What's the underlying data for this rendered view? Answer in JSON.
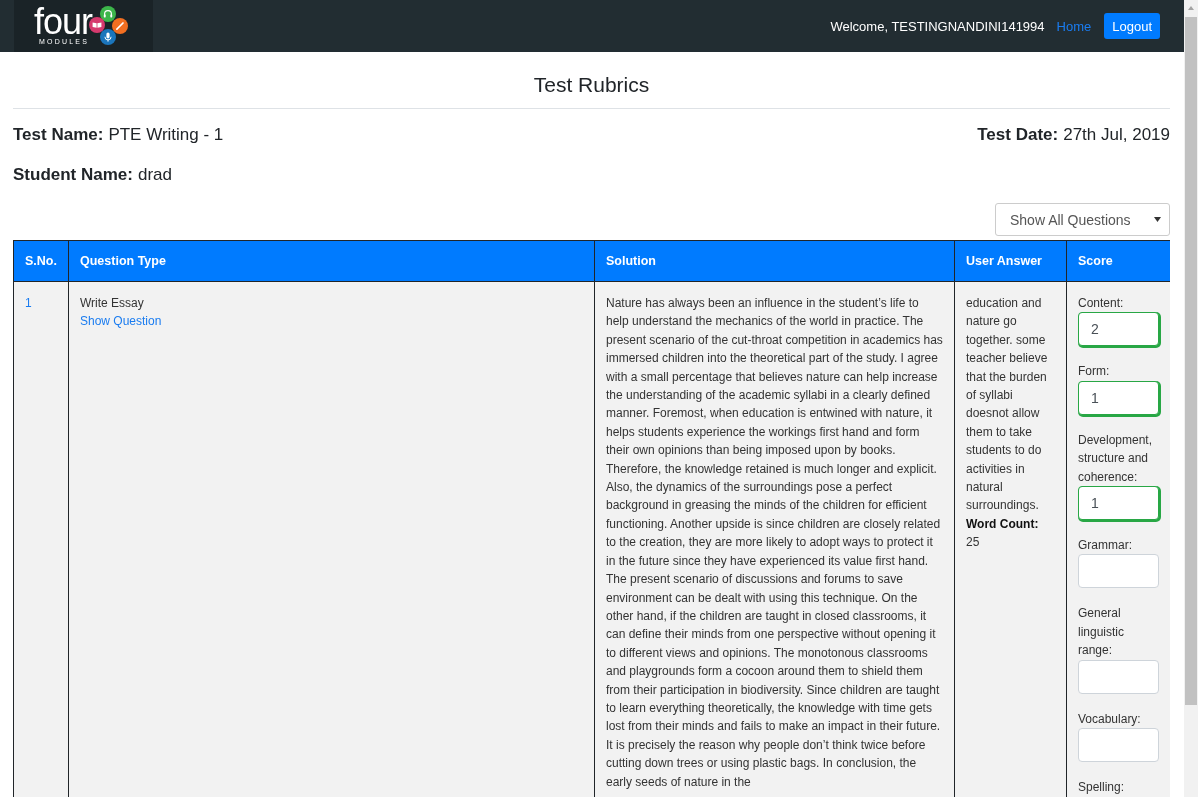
{
  "navbar": {
    "logo": {
      "word": "four",
      "tagline": "MODULES"
    },
    "welcome": "Welcome, TESTINGNANDINI141994",
    "links": [
      {
        "label": "Home",
        "kind": "link"
      },
      {
        "label": "Logout",
        "kind": "button"
      }
    ]
  },
  "page": {
    "title": "Test Rubrics",
    "test_name": {
      "label": "Test Name:",
      "value": "PTE Writing - 1"
    },
    "test_date": {
      "label": "Test Date:",
      "value": "27th Jul, 2019"
    },
    "student_name": {
      "label": "Student Name:",
      "value": "drad"
    },
    "filter": {
      "value": "Show All Questions"
    }
  },
  "table": {
    "columns": [
      "S.No.",
      "Question Type",
      "Solution",
      "User Answer",
      "Score"
    ],
    "rows": [
      {
        "number": "1",
        "question_type": "Write Essay",
        "show_question": "Show Question",
        "solution": "Nature has always been an influence in the student’s life to help understand the mechanics of the world in practice. The present scenario of the cut-throat competition in academics has immersed children into the theoretical part of the study. I agree with a small percentage that believes nature can help increase the understanding of the academic syllabi in a clearly defined manner. Foremost, when education is entwined with nature, it helps students experience the workings first hand and form their own opinions than being imposed upon by books. Therefore, the knowledge retained is much longer and explicit. Also, the dynamics of the surroundings pose a perfect background in greasing the minds of the children for efficient functioning. Another upside is since children are closely related to the creation, they are more likely to adopt ways to protect it in the future since they have experienced its value first hand. The present scenario of discussions and forums to save environment can be dealt with using this technique. On the other hand, if the children are taught in closed classrooms, it can define their minds from one perspective without opening it to different views and opinions. The monotonous classrooms and playgrounds form a cocoon around them to shield them from their participation in biodiversity. Since children are taught to learn everything theoretically, the knowledge with time gets lost from their minds and fails to make an impact in their future. It is precisely the reason why people don’t think twice before cutting down trees or using plastic bags. In conclusion, the early seeds of nature in the",
        "user_answer": "education and nature go together. some teacher believe that the burden of syllabi doesnot allow them to take students to do activities in natural surroundings.",
        "word_count_label": "Word Count:",
        "word_count": "25",
        "scores": [
          {
            "label": "Content:",
            "kind": "input",
            "value": "2",
            "valid": true
          },
          {
            "label": "Form:",
            "kind": "input",
            "value": "1",
            "valid": true
          },
          {
            "label": "Development, structure and coherence:",
            "kind": "input",
            "value": "1",
            "valid": true
          },
          {
            "label": "Grammar:",
            "kind": "input",
            "valid": false
          },
          {
            "label": "General linguistic range:",
            "kind": "input",
            "valid": false
          },
          {
            "label": "Vocabulary:",
            "kind": "input",
            "valid": false
          },
          {
            "label": "Spelling:",
            "kind": "label"
          }
        ]
      }
    ]
  }
}
